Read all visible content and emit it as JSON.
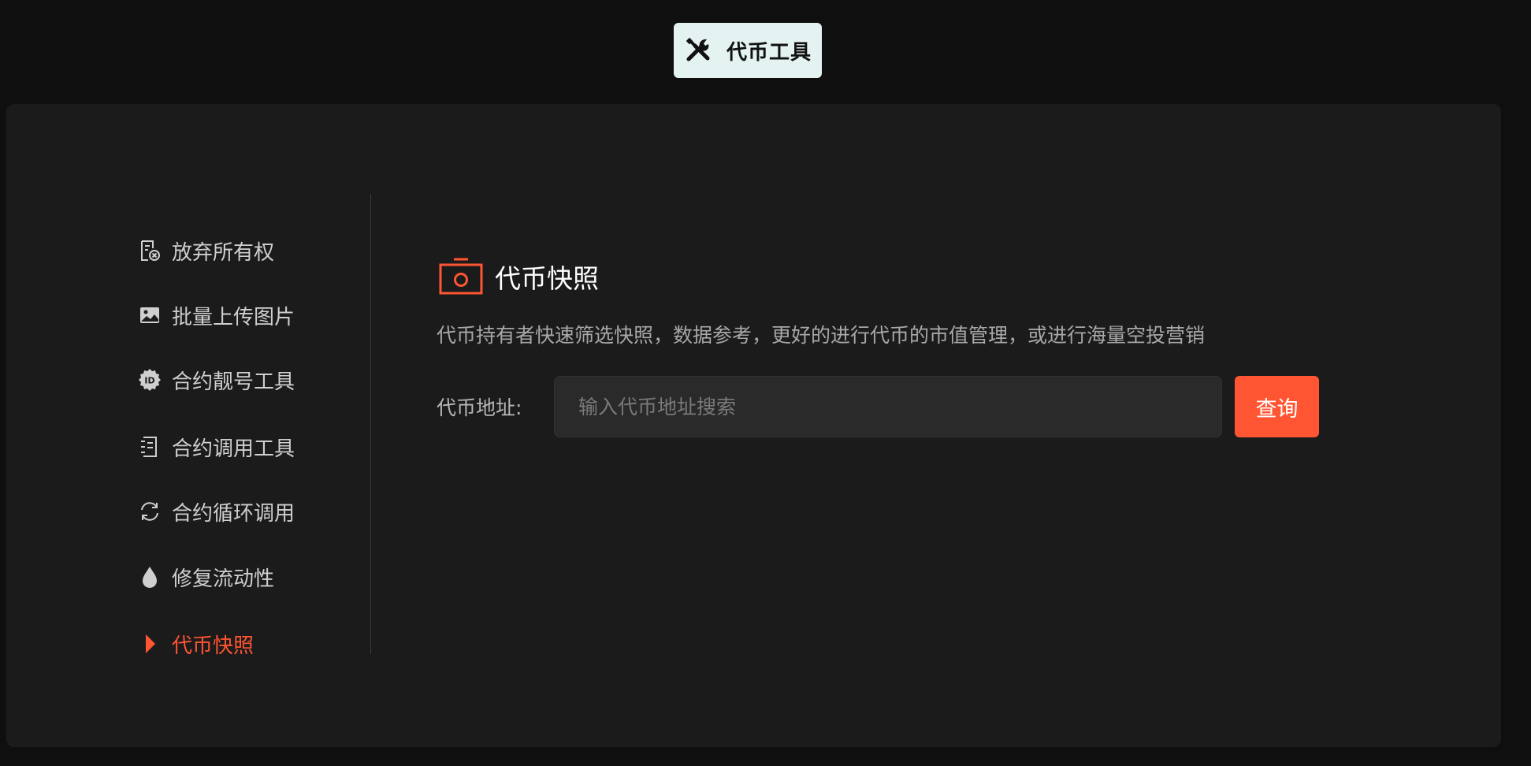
{
  "top_tab": {
    "label": "代币工具",
    "icon": "tools-icon"
  },
  "sidebar": {
    "items": [
      {
        "label": "放弃所有权",
        "icon": "renounce-ownership-icon",
        "active": false
      },
      {
        "label": "批量上传图片",
        "icon": "image-icon",
        "active": false
      },
      {
        "label": "合约靓号工具",
        "icon": "id-badge-icon",
        "active": false
      },
      {
        "label": "合约调用工具",
        "icon": "contract-document-icon",
        "active": false
      },
      {
        "label": "合约循环调用",
        "icon": "refresh-icon",
        "active": false
      },
      {
        "label": "修复流动性",
        "icon": "droplet-icon",
        "active": false
      },
      {
        "label": "代币快照",
        "icon": "caret-right-icon",
        "active": true
      }
    ]
  },
  "content": {
    "title": "代币快照",
    "description": "代币持有者快速筛选快照，数据参考，更好的进行代币的市值管理，或进行海量空投营销",
    "address_label": "代币地址:",
    "address_placeholder": "输入代币地址搜索",
    "address_value": "",
    "query_label": "查询"
  },
  "colors": {
    "accent": "#ff5533",
    "panel_bg": "#1b1b1b",
    "page_bg": "#0f0f0f",
    "tab_bg": "#e4f2f2"
  }
}
